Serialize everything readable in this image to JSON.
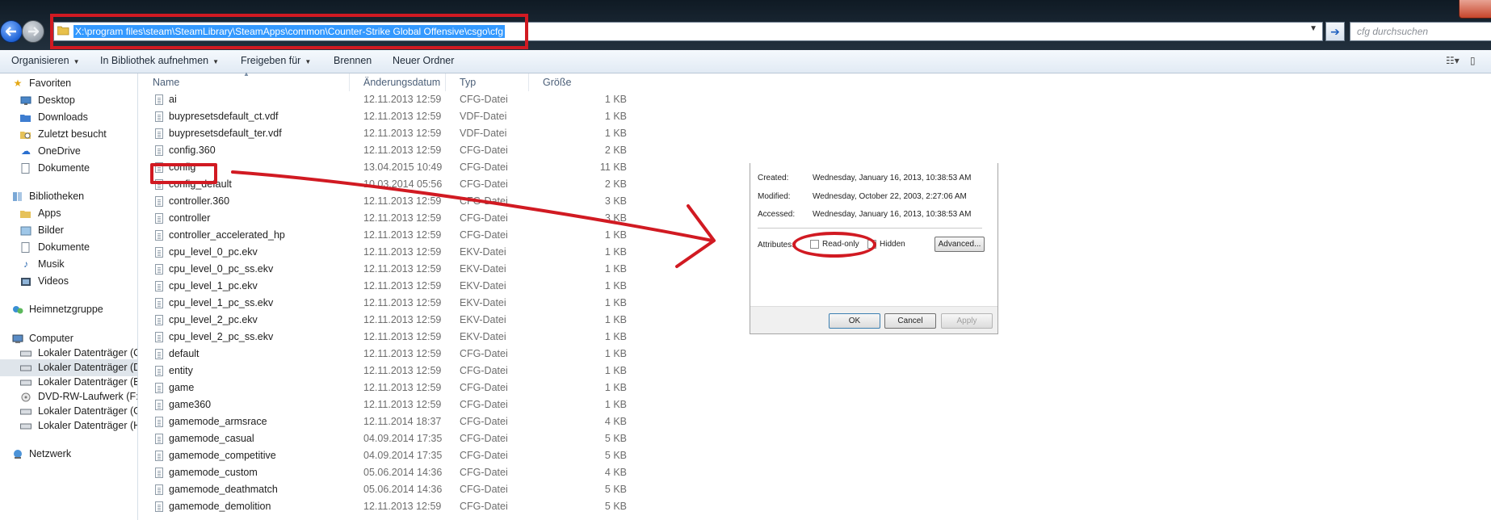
{
  "address_bar": {
    "path": "X:\\program files\\steam\\SteamLibrary\\SteamApps\\common\\Counter-Strike Global Offensive\\csgo\\cfg",
    "search_placeholder": "cfg durchsuchen"
  },
  "toolbar": {
    "organize": "Organisieren",
    "library": "In Bibliothek aufnehmen",
    "share": "Freigeben für",
    "burn": "Brennen",
    "new_folder": "Neuer Ordner"
  },
  "nav": {
    "favorites": "Favoriten",
    "desktop": "Desktop",
    "downloads": "Downloads",
    "recent": "Zuletzt besucht",
    "onedrive": "OneDrive",
    "documents": "Dokumente",
    "libraries": "Bibliotheken",
    "apps": "Apps",
    "pictures": "Bilder",
    "lib_documents": "Dokumente",
    "music": "Musik",
    "videos": "Videos",
    "homegroup": "Heimnetzgruppe",
    "computer": "Computer",
    "drive_c": "Lokaler Datenträger (C:",
    "drive_d": "Lokaler Datenträger (D:",
    "drive_e": "Lokaler Datenträger (E:)",
    "drive_f": "DVD-RW-Laufwerk (F:)",
    "drive_g": "Lokaler Datenträger (G:",
    "drive_h": "Lokaler Datenträger (H:",
    "network": "Netzwerk"
  },
  "columns": {
    "name": "Name",
    "date": "Änderungsdatum",
    "type": "Typ",
    "size": "Größe"
  },
  "files": [
    {
      "name": "ai",
      "date": "12.11.2013 12:59",
      "type": "CFG-Datei",
      "size": "1 KB"
    },
    {
      "name": "buypresetsdefault_ct.vdf",
      "date": "12.11.2013 12:59",
      "type": "VDF-Datei",
      "size": "1 KB"
    },
    {
      "name": "buypresetsdefault_ter.vdf",
      "date": "12.11.2013 12:59",
      "type": "VDF-Datei",
      "size": "1 KB"
    },
    {
      "name": "config.360",
      "date": "12.11.2013 12:59",
      "type": "CFG-Datei",
      "size": "2 KB"
    },
    {
      "name": "config",
      "date": "13.04.2015 10:49",
      "type": "CFG-Datei",
      "size": "11 KB"
    },
    {
      "name": "config_default",
      "date": "10.03.2014 05:56",
      "type": "CFG-Datei",
      "size": "2 KB"
    },
    {
      "name": "controller.360",
      "date": "12.11.2013 12:59",
      "type": "CFG-Datei",
      "size": "3 KB"
    },
    {
      "name": "controller",
      "date": "12.11.2013 12:59",
      "type": "CFG-Datei",
      "size": "3 KB"
    },
    {
      "name": "controller_accelerated_hp",
      "date": "12.11.2013 12:59",
      "type": "CFG-Datei",
      "size": "1 KB"
    },
    {
      "name": "cpu_level_0_pc.ekv",
      "date": "12.11.2013 12:59",
      "type": "EKV-Datei",
      "size": "1 KB"
    },
    {
      "name": "cpu_level_0_pc_ss.ekv",
      "date": "12.11.2013 12:59",
      "type": "EKV-Datei",
      "size": "1 KB"
    },
    {
      "name": "cpu_level_1_pc.ekv",
      "date": "12.11.2013 12:59",
      "type": "EKV-Datei",
      "size": "1 KB"
    },
    {
      "name": "cpu_level_1_pc_ss.ekv",
      "date": "12.11.2013 12:59",
      "type": "EKV-Datei",
      "size": "1 KB"
    },
    {
      "name": "cpu_level_2_pc.ekv",
      "date": "12.11.2013 12:59",
      "type": "EKV-Datei",
      "size": "1 KB"
    },
    {
      "name": "cpu_level_2_pc_ss.ekv",
      "date": "12.11.2013 12:59",
      "type": "EKV-Datei",
      "size": "1 KB"
    },
    {
      "name": "default",
      "date": "12.11.2013 12:59",
      "type": "CFG-Datei",
      "size": "1 KB"
    },
    {
      "name": "entity",
      "date": "12.11.2013 12:59",
      "type": "CFG-Datei",
      "size": "1 KB"
    },
    {
      "name": "game",
      "date": "12.11.2013 12:59",
      "type": "CFG-Datei",
      "size": "1 KB"
    },
    {
      "name": "game360",
      "date": "12.11.2013 12:59",
      "type": "CFG-Datei",
      "size": "1 KB"
    },
    {
      "name": "gamemode_armsrace",
      "date": "12.11.2014 18:37",
      "type": "CFG-Datei",
      "size": "4 KB"
    },
    {
      "name": "gamemode_casual",
      "date": "04.09.2014 17:35",
      "type": "CFG-Datei",
      "size": "5 KB"
    },
    {
      "name": "gamemode_competitive",
      "date": "04.09.2014 17:35",
      "type": "CFG-Datei",
      "size": "5 KB"
    },
    {
      "name": "gamemode_custom",
      "date": "05.06.2014 14:36",
      "type": "CFG-Datei",
      "size": "4 KB"
    },
    {
      "name": "gamemode_deathmatch",
      "date": "05.06.2014 14:36",
      "type": "CFG-Datei",
      "size": "5 KB"
    },
    {
      "name": "gamemode_demolition",
      "date": "12.11.2013 12:59",
      "type": "CFG-Datei",
      "size": "5 KB"
    }
  ],
  "properties_dialog": {
    "created_label": "Created:",
    "created_value": "Wednesday, January 16, 2013, 10:38:53 AM",
    "modified_label": "Modified:",
    "modified_value": "Wednesday, October 22, 2003, 2:27:06 AM",
    "accessed_label": "Accessed:",
    "accessed_value": "Wednesday, January 16, 2013, 10:38:53 AM",
    "attributes_label": "Attributes:",
    "readonly_label": "Read-only",
    "hidden_label": "Hidden",
    "advanced_button": "Advanced...",
    "ok_button": "OK",
    "cancel_button": "Cancel",
    "apply_button": "Apply"
  },
  "colors": {
    "annotation_red": "#d11a22",
    "selection_blue": "#3399ff"
  }
}
